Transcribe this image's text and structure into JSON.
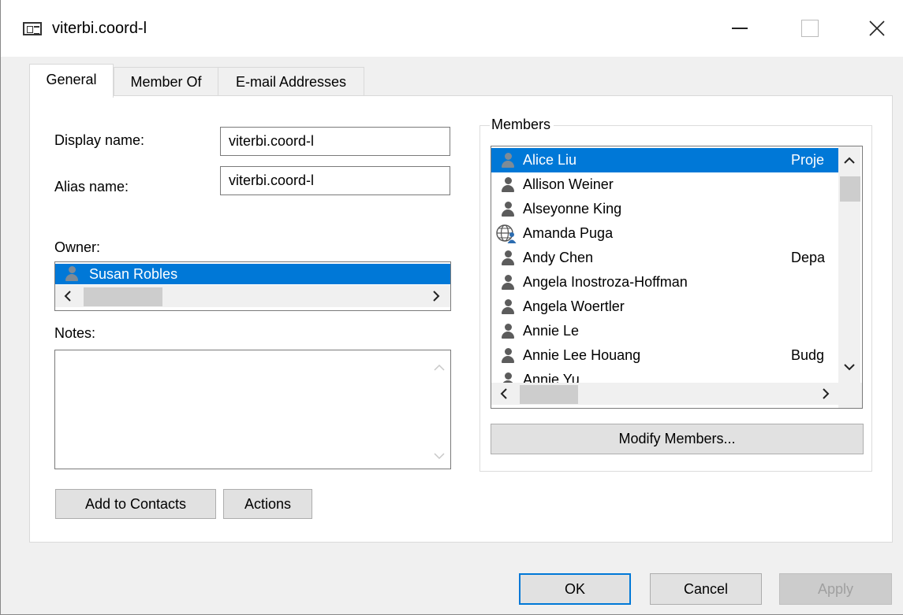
{
  "window": {
    "title": "viterbi.coord-l",
    "icon": "address-card-icon"
  },
  "tabs": [
    {
      "label": "General",
      "active": true
    },
    {
      "label": "Member Of",
      "active": false
    },
    {
      "label": "E-mail Addresses",
      "active": false
    }
  ],
  "general": {
    "display_name_label": "Display name:",
    "display_name_value": "viterbi.coord-l",
    "alias_name_label": "Alias name:",
    "alias_name_value": "viterbi.coord-l",
    "owner_label": "Owner:",
    "owner_value": "Susan Robles",
    "notes_label": "Notes:",
    "notes_value": "",
    "add_to_contacts_label": "Add to Contacts",
    "actions_label": "Actions"
  },
  "members": {
    "group_label": "Members",
    "modify_members_label": "Modify Members...",
    "list": [
      {
        "name": "Alice Liu",
        "dept": "Proje",
        "selected": true,
        "icon": "person-icon"
      },
      {
        "name": "Allison Weiner",
        "dept": "",
        "selected": false,
        "icon": "person-icon"
      },
      {
        "name": "Alseyonne King",
        "dept": "",
        "selected": false,
        "icon": "person-icon"
      },
      {
        "name": "Amanda Puga",
        "dept": "",
        "selected": false,
        "icon": "globe-person-icon"
      },
      {
        "name": "Andy Chen",
        "dept": "Depa",
        "selected": false,
        "icon": "person-icon"
      },
      {
        "name": "Angela Inostroza-Hoffman",
        "dept": "",
        "selected": false,
        "icon": "person-icon"
      },
      {
        "name": "Angela Woertler",
        "dept": "",
        "selected": false,
        "icon": "person-icon"
      },
      {
        "name": "Annie Le",
        "dept": "",
        "selected": false,
        "icon": "person-icon"
      },
      {
        "name": "Annie Lee Houang",
        "dept": "Budg",
        "selected": false,
        "icon": "person-icon"
      },
      {
        "name": "Annie Yu",
        "dept": "",
        "selected": false,
        "icon": "person-icon"
      }
    ]
  },
  "footer": {
    "ok_label": "OK",
    "cancel_label": "Cancel",
    "apply_label": "Apply"
  },
  "colors": {
    "selection": "#0078d7",
    "window_bg": "#f0f0f0",
    "panel_bg": "#ffffff"
  }
}
